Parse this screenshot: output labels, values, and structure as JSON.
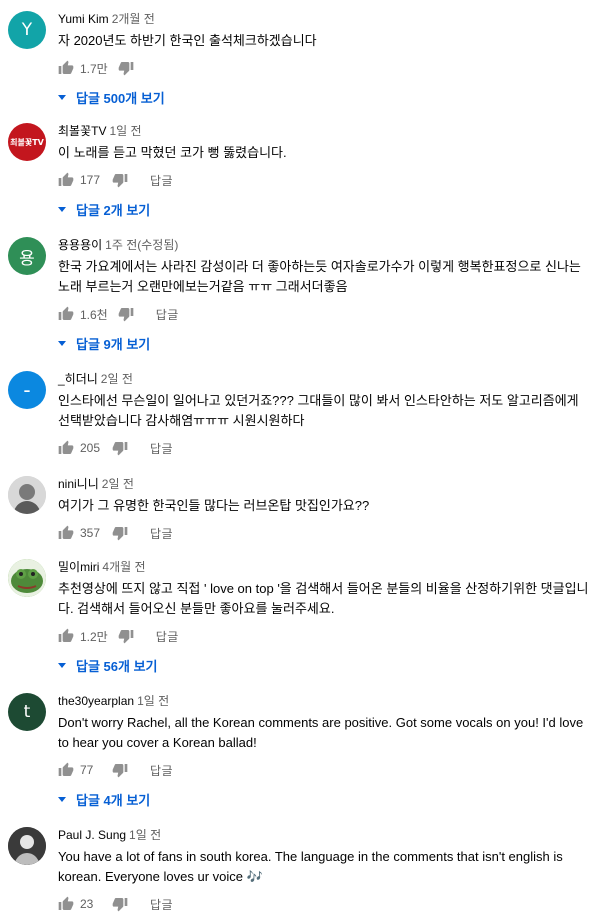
{
  "comments": [
    {
      "author": "Yumi Kim",
      "time": "2개월 전",
      "avatar_letter": "Y",
      "avatar_color": "#12a4a8",
      "text": "자 2020년도 하반기 한국인 출석체크하겠습니다",
      "likes": "1.7만",
      "reply": "",
      "view_replies": "답글 500개 보기"
    },
    {
      "author": "최볼꽃TV",
      "time": "1일 전",
      "avatar_letter": "최볼꽃TV",
      "avatar_color": "#c3161e",
      "text": "이 노래를 듣고 막혔던 코가 뻥 뚫렸습니다.",
      "likes": "177",
      "reply": "답글",
      "view_replies": "답글 2개 보기"
    },
    {
      "author": "용용용이",
      "time": "1주 전(수정됨)",
      "avatar_letter": "용",
      "avatar_color": "#2f8f57",
      "text": "한국 가요계에서는 사라진 감성이라 더 좋아하는듯 여자솔로가수가 이렇게 행복한표정으로 신나는 노래 부르는거 오랜만에보는거같음 ㅠㅠ 그래서더좋음",
      "likes": "1.6천",
      "reply": "답글",
      "view_replies": "답글 9개 보기"
    },
    {
      "author": "_히더니",
      "time": "2일 전",
      "avatar_letter": "-",
      "avatar_color": "#0b88e0",
      "text": "인스타에선 무슨일이 일어나고 있던거죠??? 그대들이 많이 봐서 인스타안하는 저도 알고리즘에게 선택받았습니다 감사해염ㅠㅠㅠ 시원시원하다",
      "likes": "205",
      "reply": "답글",
      "view_replies": ""
    },
    {
      "author": "nini니니",
      "time": "2일 전",
      "avatar_letter": "",
      "avatar_color": "#b9b9b9",
      "text": "여기가 그 유명한 한국인들 많다는 러브온탑 맛집인가요??",
      "likes": "357",
      "reply": "답글",
      "view_replies": ""
    },
    {
      "author": "밀이miri",
      "time": "4개월 전",
      "avatar_letter": "",
      "avatar_color": "#4e8a3a",
      "text": "추천영상에 뜨지 않고 직접 ' love on top '을 검색해서 들어온 분들의 비율을 산정하기위한 댓글입니다. 검색해서 들어오신 분들만 좋아요를 눌러주세요.",
      "likes": "1.2만",
      "reply": "답글",
      "view_replies": "답글 56개 보기"
    },
    {
      "author": "the30yearplan",
      "time": "1일 전",
      "avatar_letter": "t",
      "avatar_color": "#1d4a33",
      "text": "Don't worry Rachel, all the Korean comments are positive. Got some vocals on you! I'd love to hear you cover a Korean ballad!",
      "likes": "77",
      "reply": "답글",
      "view_replies": "답글 4개 보기"
    },
    {
      "author": "Paul J. Sung",
      "time": "1일 전",
      "avatar_letter": "",
      "avatar_color": "#555555",
      "text": "You have a lot of fans in south korea. The language in the comments that isn't english is korean. Everyone loves ur voice 🎶",
      "likes": "23",
      "reply": "답글",
      "view_replies": ""
    }
  ],
  "icons": {
    "like": "thumb-up-icon",
    "dislike": "thumb-down-icon",
    "expand": "caret-down-icon"
  },
  "colors": {
    "link": "#065fd4",
    "meta": "#606060",
    "text": "#030303"
  }
}
